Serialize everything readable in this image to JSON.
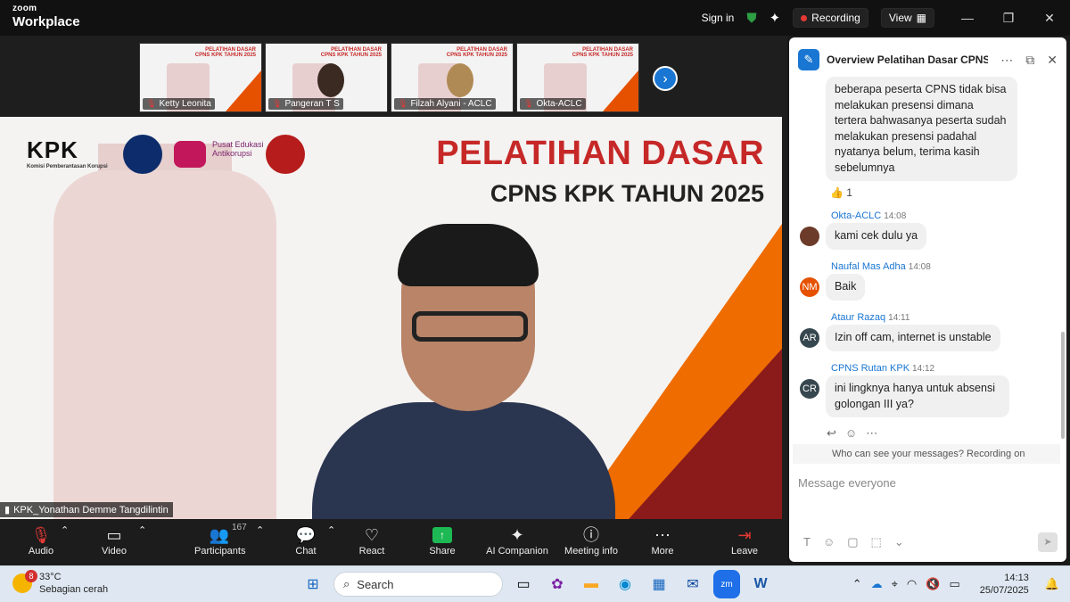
{
  "titlebar": {
    "brand_top": "zoom",
    "brand_bottom": "Workplace",
    "sign_in": "Sign in",
    "recording": "Recording",
    "view": "View",
    "colors": {
      "recording_dot": "#e53935",
      "shield": "#2e7d32"
    }
  },
  "thumbnails": [
    {
      "name": "Ketty Leonita",
      "variant": "slide"
    },
    {
      "name": "Pangeran T S",
      "variant": "person"
    },
    {
      "name": "Filzah Alyani - ACLC",
      "variant": "hijab"
    },
    {
      "name": "Okta-ACLC",
      "variant": "slide"
    }
  ],
  "slide": {
    "org_logo": "KPK",
    "org_sub": "Komisi Pemberantasan Korupsi",
    "pusat": "Pusat Edukasi Antikorupsi",
    "headline_1": "PELATIHAN DASAR",
    "headline_2": "CPNS KPK TAHUN 2025",
    "mini_title_1": "PELATIHAN DASAR",
    "mini_title_2": "CPNS KPK TAHUN 2025"
  },
  "speaker": {
    "name": "KPK_Yonathan Demme Tangdilintin"
  },
  "toolbar": {
    "audio": "Audio",
    "video": "Video",
    "participants": "Participants",
    "participants_count": "167",
    "chat": "Chat",
    "react": "React",
    "share": "Share",
    "ai": "AI Companion",
    "info": "Meeting info",
    "more": "More",
    "leave": "Leave"
  },
  "chat": {
    "title": "Overview Pelatihan Dasar CPNS ...",
    "first_message": "beberapa peserta CPNS tidak bisa melakukan presensi dimana tertera bahwasanya peserta sudah melakukan presensi padahal nyatanya belum, terima kasih sebelumnya",
    "reaction": "👍 1",
    "messages": [
      {
        "sender": "Okta-ACLC",
        "time": "14:08",
        "text": "kami cek dulu ya",
        "initials": "",
        "color": "#6d3b2a"
      },
      {
        "sender": "Naufal Mas Adha",
        "time": "14:08",
        "text": "Baik",
        "initials": "NM",
        "color": "#e65100"
      },
      {
        "sender": "Ataur Razaq",
        "time": "14:11",
        "text": "Izin off cam, internet is unstable",
        "initials": "AR",
        "color": "#37474f"
      },
      {
        "sender": "CPNS Rutan KPK",
        "time": "14:12",
        "text": "ini lingknya hanya untuk absensi golongan III ya?",
        "initials": "CR",
        "color": "#37474f"
      }
    ],
    "visibility_note": "Who can see your messages? Recording on",
    "input_placeholder": "Message everyone"
  },
  "taskbar": {
    "temp": "33°C",
    "weather": "Sebagian cerah",
    "weather_badge": "8",
    "search": "Search",
    "time": "14:13",
    "date": "25/07/2025"
  }
}
